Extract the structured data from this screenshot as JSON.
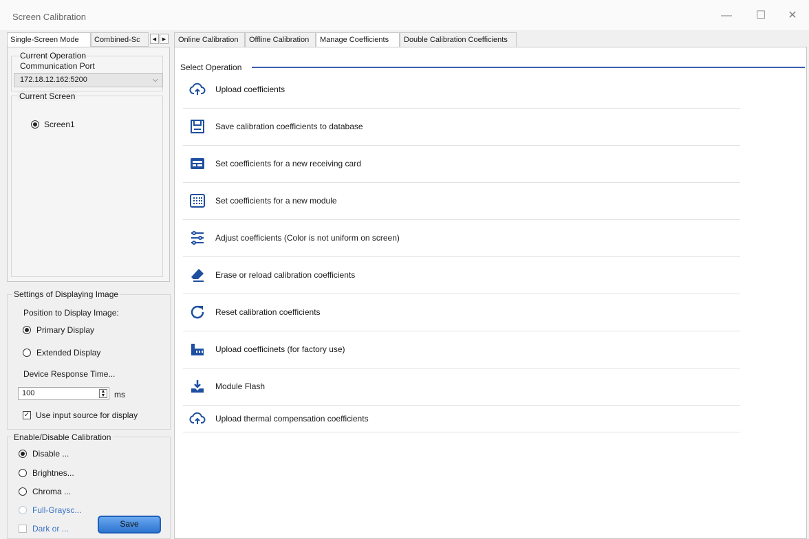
{
  "window": {
    "title": "Screen Calibration",
    "minimize": "—",
    "maximize": "☐",
    "close": "✕"
  },
  "left_tabs": {
    "tab1": "Single-Screen Mode",
    "tab2": "Combined-Sc",
    "prev": "◀",
    "next": "▶"
  },
  "current_operation": {
    "group_label": "Current Operation",
    "port_label": "Communication Port",
    "port_value": "172.18.12.162:5200",
    "screen_group_label": "Current Screen",
    "screen_item": "Screen1"
  },
  "display_settings": {
    "group_label": "Settings of Displaying Image",
    "position_label": "Position to Display Image:",
    "primary": "Primary Display",
    "extended": "Extended Display",
    "response_label": "Device Response Time...",
    "response_value": "100",
    "response_unit": "ms",
    "use_input_source": "Use input source for display"
  },
  "calibration": {
    "group_label": "Enable/Disable Calibration",
    "disable": "Disable ...",
    "brightness": "Brightnes...",
    "chroma": "Chroma ...",
    "full_gray": "Full-Graysc...",
    "dark": "Dark or ...",
    "save": "Save"
  },
  "right_tabs": [
    "Online Calibration",
    "Offline Calibration",
    "Manage Coefficients",
    "Double Calibration Coefficients"
  ],
  "select_operation": "Select Operation",
  "operations": [
    {
      "label": "Upload coefficients",
      "icon": "cloud-upload-icon"
    },
    {
      "label": "Save calibration coefficients to database",
      "icon": "save-icon"
    },
    {
      "label": "Set coefficients for a new receiving card",
      "icon": "receiving-card-icon"
    },
    {
      "label": "Set coefficients for a new module",
      "icon": "module-grid-icon"
    },
    {
      "label": "Adjust coefficients (Color is not uniform on screen)",
      "icon": "sliders-icon"
    },
    {
      "label": "Erase or reload calibration coefficients",
      "icon": "eraser-icon"
    },
    {
      "label": "Reset calibration coefficients",
      "icon": "reset-icon"
    },
    {
      "label": "Upload coefficinets (for factory use)",
      "icon": "factory-icon"
    },
    {
      "label": "Module Flash",
      "icon": "download-flash-icon"
    },
    {
      "label": "Upload thermal compensation coefficients",
      "icon": "cloud-upload-icon"
    }
  ],
  "colors": {
    "accent": "#1e4fa0",
    "divider": "#3a5fb0",
    "disabled_text": "#3a72c4"
  }
}
